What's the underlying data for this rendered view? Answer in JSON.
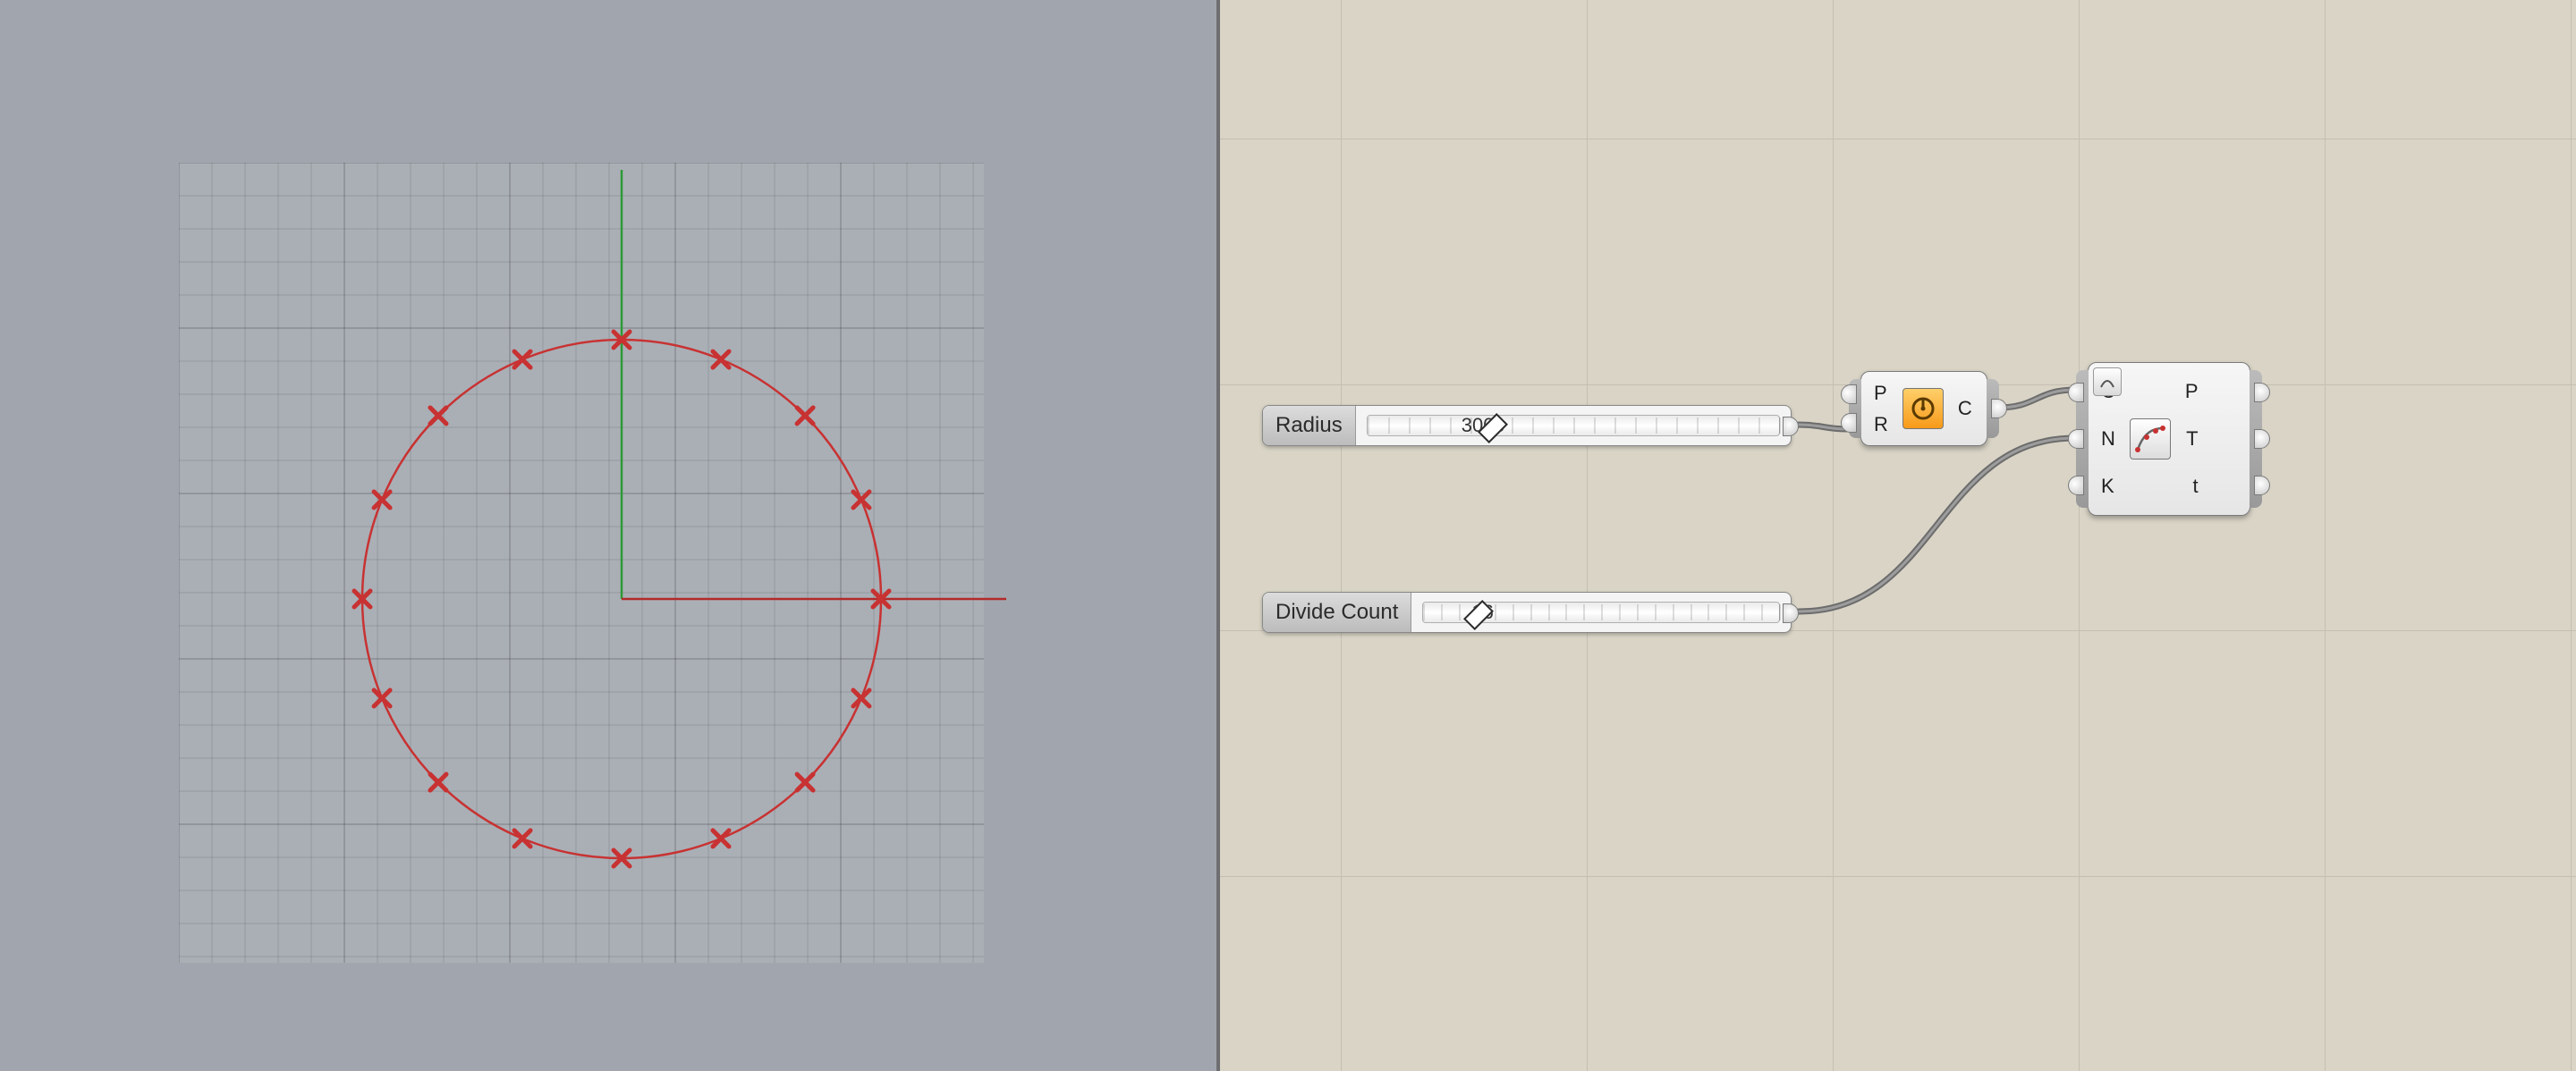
{
  "viewport": {
    "circle_radius": 3000,
    "divide_count": 16
  },
  "sliders": {
    "radius": {
      "label": "Radius",
      "value_text": "3000",
      "handle_pct": 30
    },
    "divide": {
      "label": "Divide Count",
      "value_text": "16",
      "handle_pct": 15
    }
  },
  "nodes": {
    "circle": {
      "inputs": [
        "P",
        "R"
      ],
      "outputs": [
        "C"
      ],
      "icon": "circle-cnr-icon"
    },
    "divideCurve": {
      "inputs": [
        "C",
        "N",
        "K"
      ],
      "outputs": [
        "P",
        "T",
        "t"
      ],
      "icon": "divide-curve-icon"
    }
  },
  "colors": {
    "circle_red": "#c83232",
    "axis_green": "#2e9935",
    "axis_red": "#b22a2a",
    "icon_orange": "#f79a1a"
  }
}
